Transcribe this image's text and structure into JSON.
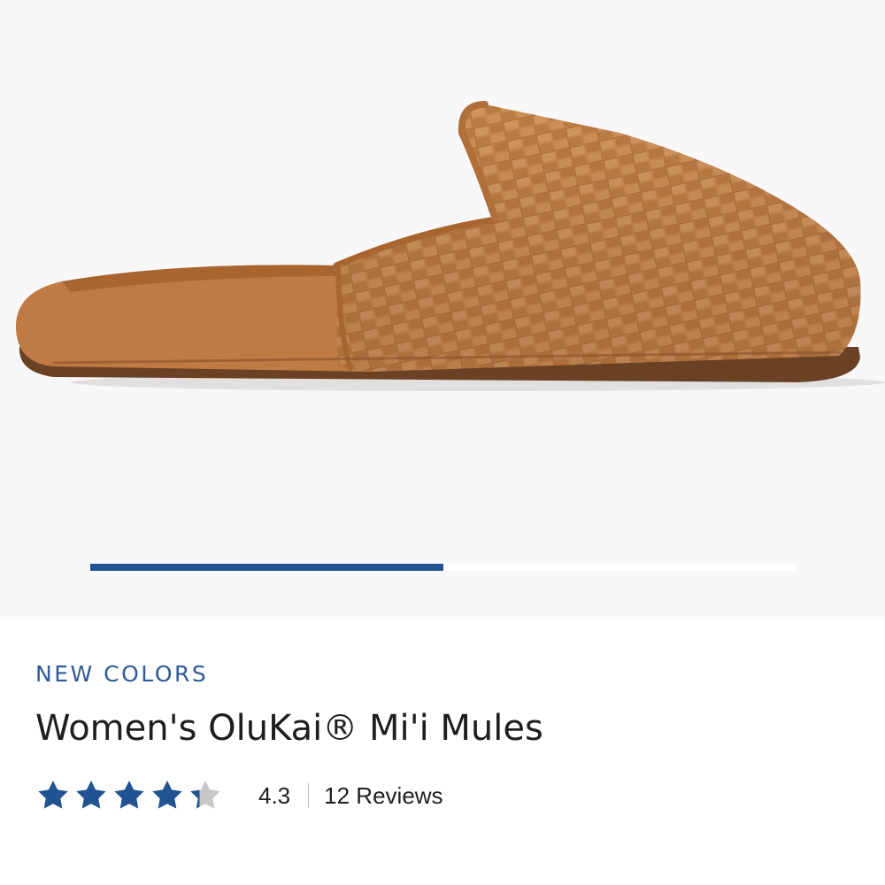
{
  "product": {
    "badge": "NEW COLORS",
    "title": "Women's OluKai® Mi'i Mules",
    "image_alt": "Tan woven leather mule, side view"
  },
  "carousel": {
    "progress": 0.5
  },
  "rating": {
    "value": "4.3",
    "score": 4.3,
    "max": 5,
    "reviews_label": "12 Reviews"
  },
  "colors": {
    "accent": "#215392",
    "star_filled": "#215392",
    "star_empty": "#c8c8c8",
    "leather": "#c17f4a",
    "background": "#f8f8fa"
  }
}
